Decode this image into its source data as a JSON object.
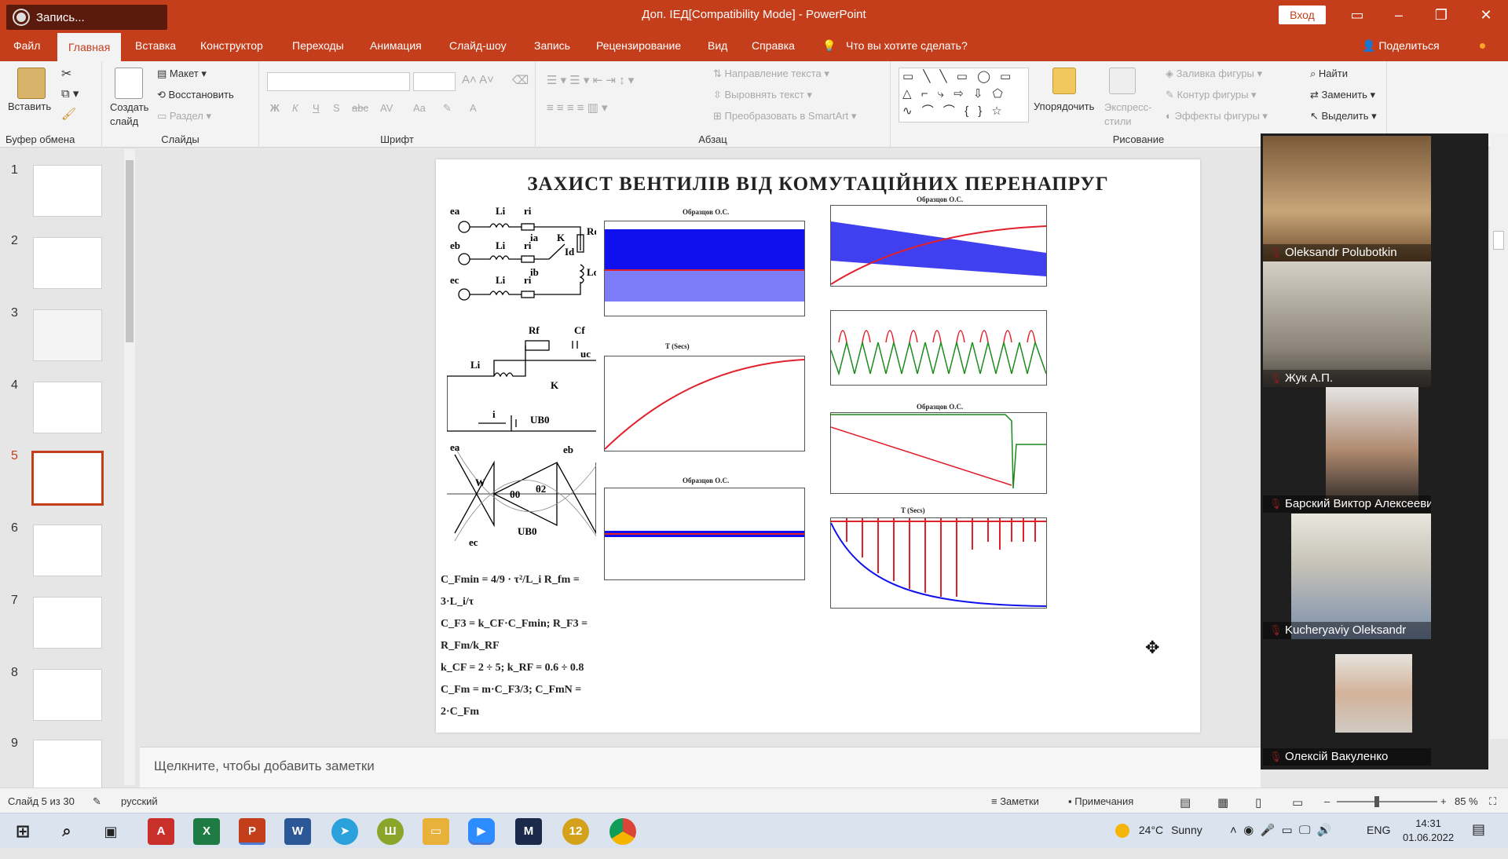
{
  "titlebar": {
    "record_label": "Запись...",
    "doc_title": "Доп. ІЕД[Compatibility Mode] - PowerPoint",
    "signin": "Вход"
  },
  "menu": {
    "tabs": [
      "Файл",
      "Главная",
      "Вставка",
      "Конструктор",
      "Переходы",
      "Анимация",
      "Слайд-шоу",
      "Запись",
      "Рецензирование",
      "Вид",
      "Справка"
    ],
    "search_placeholder": "Что вы хотите сделать?",
    "share": "Поделиться"
  },
  "ribbon": {
    "clipboard": {
      "paste": "Вставить",
      "group": "Буфер обмена"
    },
    "slides": {
      "new_slide": "Создать слайд",
      "layout": "Макет",
      "reset": "Восстановить",
      "section": "Раздел",
      "group": "Слайды"
    },
    "font": {
      "group": "Шрифт",
      "bold": "Ж",
      "italic": "К",
      "underline": "Ч",
      "shadow": "S",
      "strike": "abc",
      "spacing": "AV",
      "case": "Aa",
      "color": "A"
    },
    "paragraph": {
      "group": "Абзац",
      "text_direction": "Направление текста",
      "align_text": "Выровнять текст",
      "smartart": "Преобразовать в SmartArt"
    },
    "drawing": {
      "group": "Рисование",
      "arrange": "Упорядочить",
      "quick_styles": "Экспресс-стили",
      "fill": "Заливка фигуры",
      "outline": "Контур фигуры",
      "effects": "Эффекты фигуры"
    },
    "editing": {
      "find": "Найти",
      "replace": "Заменить",
      "select": "Выделить"
    }
  },
  "slides_panel": {
    "numbers": [
      "1",
      "2",
      "3",
      "4",
      "5",
      "6",
      "7",
      "8",
      "9"
    ],
    "selected": 5
  },
  "slide": {
    "title": "ЗАХИСТ ВЕНТИЛІВ ВІД КОМУТАЦІЙНИХ ПЕРЕНАПРУГ",
    "formulas": [
      "C_Fmin = 4/9 · τ²/L_i      R_fm = 3·L_i/τ",
      "C_F3 = k_CF·C_Fmin; R_F3 = R_Fm/k_RF",
      "k_CF = 2 ÷ 5; k_RF = 0.6 ÷ 0.8",
      "C_Fm = m·C_F3/3; C_FmN = 2·C_Fm"
    ],
    "chart_author": "Образцов О.С.",
    "axis_time": "T (Secs)"
  },
  "notes": {
    "placeholder": "Щелкните, чтобы добавить заметки"
  },
  "status": {
    "slide_counter": "Слайд 5 из 30",
    "language": "русский",
    "notes_btn": "Заметки",
    "comments_btn": "Примечания",
    "zoom": "85 %"
  },
  "participants": [
    {
      "name": "Oleksandr Polubotkin"
    },
    {
      "name": "Жук А.П."
    },
    {
      "name": "Барский Виктор Алексеевич"
    },
    {
      "name": "Kucheryaviy Oleksandr"
    },
    {
      "name": "Олексій Вакуленко"
    }
  ],
  "tray": {
    "temperature": "24°C",
    "weather": "Sunny",
    "lang": "ENG",
    "time": "14:31",
    "date": "01.06.2022"
  },
  "colors": {
    "accent": "#c43e1c",
    "series_blue": "#1010ee",
    "series_red": "#e0202a",
    "series_green": "#1a8a1a"
  }
}
